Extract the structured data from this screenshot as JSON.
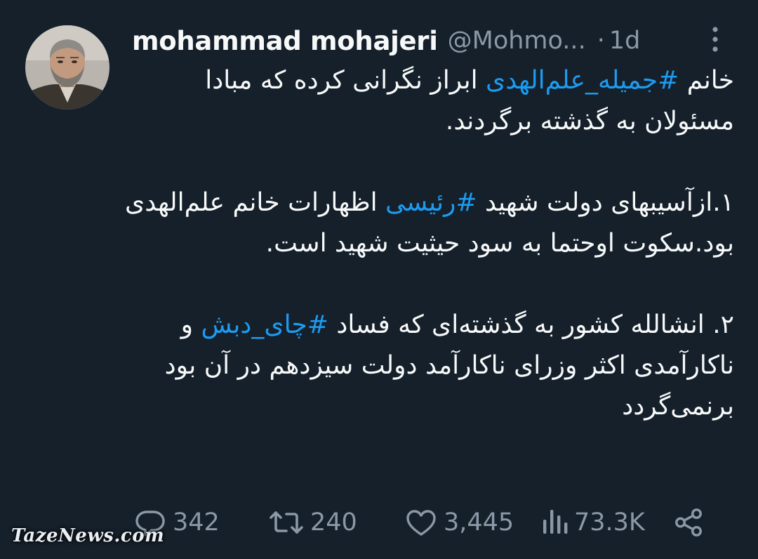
{
  "author": {
    "display_name": "mohammad mohajeri",
    "handle": "@Mohmo...",
    "separator": "·",
    "time_ago": "1d"
  },
  "tweet": {
    "p1_a": "خانم ",
    "p1_tag": "#جمیله_علم‌الهدی",
    "p1_b": " ابراز نگرانی کرده که مبادا مسئولان به گذشته برگردند.",
    "p2_a": "۱.ازآسیبهای دولت شهید ",
    "p2_tag": "#رئیسی",
    "p2_b": " اظهارات خانم علم‌الهدی بود.سکوت اوحتما به سود حیثیت شهید است.",
    "p3_a": "۲. انشالله کشور به گذشته‌ای که فساد ",
    "p3_tag": "#چای_دبش",
    "p3_b": " و ناکارآمدی اکثر وزرای ناکارآمد دولت سیزدهم در آن بود برنمی‌گردد"
  },
  "metrics": {
    "replies": "342",
    "retweets": "240",
    "likes": "3,445",
    "views": "73.3K"
  },
  "icons": [
    "more-icon",
    "reply-icon",
    "retweet-icon",
    "like-icon",
    "views-icon",
    "share-icon"
  ],
  "colors": {
    "background": "#15202b",
    "text": "#f7f9f9",
    "secondary": "#8b98a5",
    "hashtag": "#1d9bf0"
  },
  "watermark": "TazeNews.com"
}
